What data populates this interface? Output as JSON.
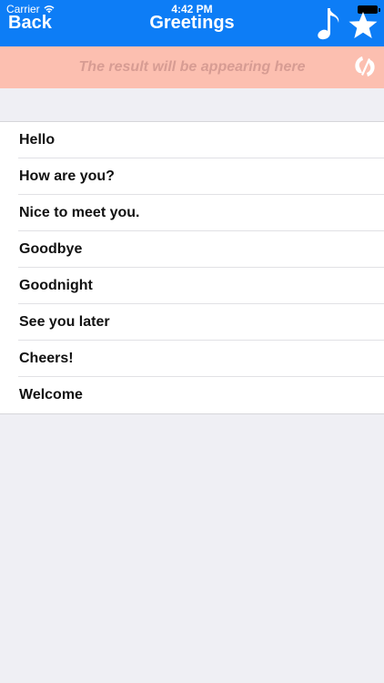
{
  "status_bar": {
    "carrier": "Carrier",
    "time": "4:42 PM"
  },
  "nav": {
    "back_label": "Back",
    "title": "Greetings",
    "icons": [
      "music-note-icon",
      "star-icon"
    ]
  },
  "result_banner": {
    "placeholder_text": "The result will be appearing here",
    "icon": "translate-icon"
  },
  "greetings": {
    "items": [
      {
        "label": "Hello"
      },
      {
        "label": "How are you?"
      },
      {
        "label": "Nice to meet you."
      },
      {
        "label": "Goodbye"
      },
      {
        "label": "Goodnight"
      },
      {
        "label": "See you later"
      },
      {
        "label": "Cheers!"
      },
      {
        "label": "Welcome"
      }
    ]
  },
  "colors": {
    "nav_bg": "#0d7df6",
    "banner_bg": "#fcbfb0",
    "banner_text": "#d79c93",
    "page_bg": "#efeff4"
  }
}
